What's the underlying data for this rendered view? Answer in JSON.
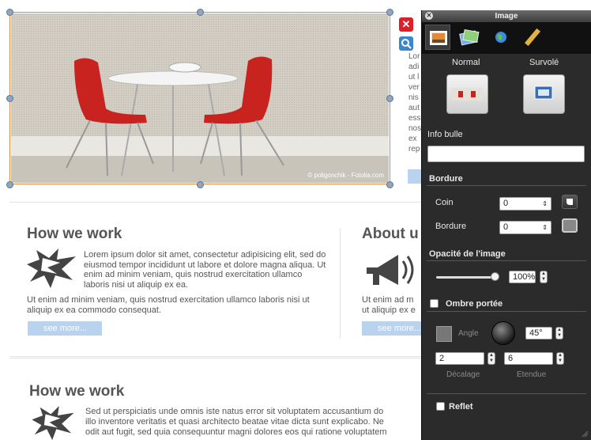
{
  "hero": {
    "credit": "© poligonchik - Fotolia.com",
    "close_symbol": "✕"
  },
  "side_text": [
    "Lor",
    "adi",
    "ut l",
    "ver",
    "nis",
    "aut",
    "ess",
    "nos",
    "ex",
    "rep"
  ],
  "section1": {
    "heading": "How we work",
    "para_indented": "Lorem ipsum dolor sit amet, consectetur adipisicing elit, sed do eiusmod tempor incididunt ut labore et dolore magna aliqua. Ut enim ad minim veniam, quis nostrud exercitation ullamco laboris nisi ut aliquip ex ea.",
    "para_full": "Ut enim ad minim veniam, quis nostrud exercitation ullamco laboris nisi ut aliquip ex ea commodo consequat.",
    "button": "see more..."
  },
  "section2": {
    "heading": "About u",
    "line1": "Ut enim ad m",
    "line2": "ut aliquip ex e",
    "button": "see more..."
  },
  "section3": {
    "heading": "How we work",
    "line1": "Sed ut perspiciatis unde omnis iste natus error sit voluptatem accusantium do",
    "line2": "illo inventore veritatis et quasi architecto beatae vitae dicta sunt explicabo. Ne",
    "line3": "odit aut fugit, sed quia consequuntur magni dolores eos qui ratione voluptatem"
  },
  "panel": {
    "title": "Image",
    "state_normal": "Normal",
    "state_hover": "Survolé",
    "tooltip_label": "Info bulle",
    "tooltip_value": "",
    "border_section": "Bordure",
    "corner_label": "Coin",
    "corner_value": "0",
    "border_label": "Bordure",
    "border_value": "0",
    "opacity_section": "Opacité de l'image",
    "opacity_value": "100%",
    "opacity_fraction": 1.0,
    "shadow_label": "Ombre portée",
    "angle_label": "Angle",
    "angle_value": "45°",
    "offset_value": "2",
    "spread_value": "6",
    "offset_label": "Décalage",
    "spread_label": "Etendue",
    "reflection_label": "Reflet"
  },
  "colors": {
    "selection_border": "#e8843c",
    "panel_bg": "#2b2b2b",
    "button_blue": "#b9d2ee"
  }
}
